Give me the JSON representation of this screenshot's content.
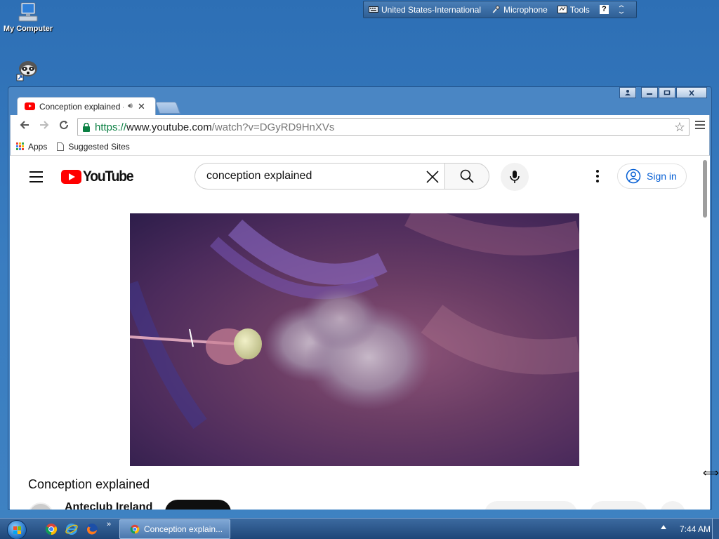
{
  "desktop": {
    "icons": [
      {
        "label": "My Computer"
      },
      {
        "label": ""
      }
    ]
  },
  "language_bar": {
    "keyboard": "United States-International",
    "microphone": "Microphone",
    "tools": "Tools",
    "help": "?"
  },
  "browser": {
    "tab": {
      "title": "Conception explained -",
      "audio_icon": "speaker-icon"
    },
    "address": {
      "protocol": "https://",
      "host": "www.youtube.com",
      "path": "/watch?v=DGyRD9HnXVs"
    },
    "bookmarks": [
      {
        "label": "Apps"
      },
      {
        "label": "Suggested Sites"
      }
    ]
  },
  "youtube": {
    "logo_text": "YouTube",
    "search": {
      "value": "conception explained"
    },
    "signin_label": "Sign in",
    "video": {
      "title": "Conception explained",
      "channel": "Anteclub Ireland"
    }
  },
  "taskbar": {
    "task_label": "Conception explain...",
    "clock": "7:44 AM"
  },
  "colors": {
    "desktop": "#3a7dc0",
    "youtube_red": "#ff0000",
    "link_blue": "#065fd4",
    "secure_green": "#0b8043"
  }
}
